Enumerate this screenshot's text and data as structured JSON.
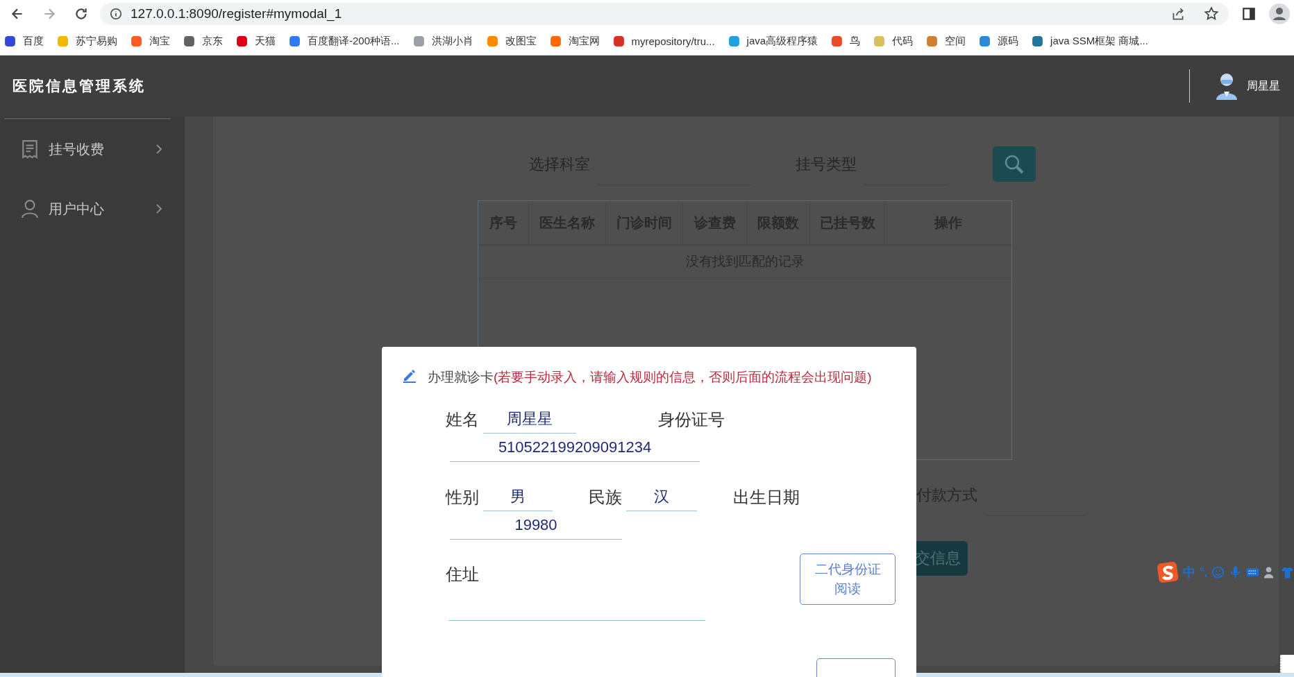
{
  "browser": {
    "url": "127.0.0.1:8090/register#mymodal_1",
    "bookmarks": [
      {
        "label": "百度",
        "color": "#3448d8"
      },
      {
        "label": "苏宁易购",
        "color": "#f5b800"
      },
      {
        "label": "淘宝",
        "color": "#ff5a1f"
      },
      {
        "label": "京东",
        "color": "#5f6368"
      },
      {
        "label": "天猫",
        "color": "#e00012"
      },
      {
        "label": "百度翻译-200种语...",
        "color": "#2b7cf0"
      },
      {
        "label": "洪湖小肖",
        "color": "#9aa0a6"
      },
      {
        "label": "改图宝",
        "color": "#ff8a00"
      },
      {
        "label": "淘宝网",
        "color": "#ff6a00"
      },
      {
        "label": "myrepository/tru...",
        "color": "#d93025"
      },
      {
        "label": "java高级程序猿",
        "color": "#20a0e0"
      },
      {
        "label": "鸟",
        "color": "#e84a2a"
      },
      {
        "label": "代码",
        "color": "#d8c060"
      },
      {
        "label": "空间",
        "color": "#d08030"
      },
      {
        "label": "源码",
        "color": "#2a8ad8"
      },
      {
        "label": "java SSM框架 商城...",
        "color": "#21759b"
      }
    ]
  },
  "header": {
    "title": "医院信息管理系统",
    "user": "周星星"
  },
  "sidebar": {
    "items": [
      {
        "label": "挂号收费",
        "kind": "register"
      },
      {
        "label": "用户中心",
        "kind": "user"
      }
    ]
  },
  "search": {
    "department_label": "选择科室",
    "type_label": "挂号类型"
  },
  "table": {
    "columns": [
      "序号",
      "医生名称",
      "门诊时间",
      "诊查费",
      "限额数",
      "已挂号数",
      "操作"
    ],
    "empty_message": "没有找到匹配的记录"
  },
  "payment": {
    "label": "付款方式"
  },
  "submit_button": "交信息",
  "modal": {
    "title": "办理就诊卡",
    "warning": "(若要手动录入，请输入规则的信息，否则后面的流程会出现问题)",
    "name_label": "姓名",
    "name_value": "周星星",
    "id_label": "身份证号",
    "id_value": "510522199209091234",
    "gender_label": "性别",
    "gender_value": "男",
    "ethnicity_label": "民族",
    "ethnicity_value": "汉",
    "birth_label": "出生日期",
    "birth_value": "19980",
    "address_label": "住址",
    "read_button": "二代身份证阅读"
  },
  "ime": {
    "mode": "中",
    "punctuation": "°,"
  }
}
